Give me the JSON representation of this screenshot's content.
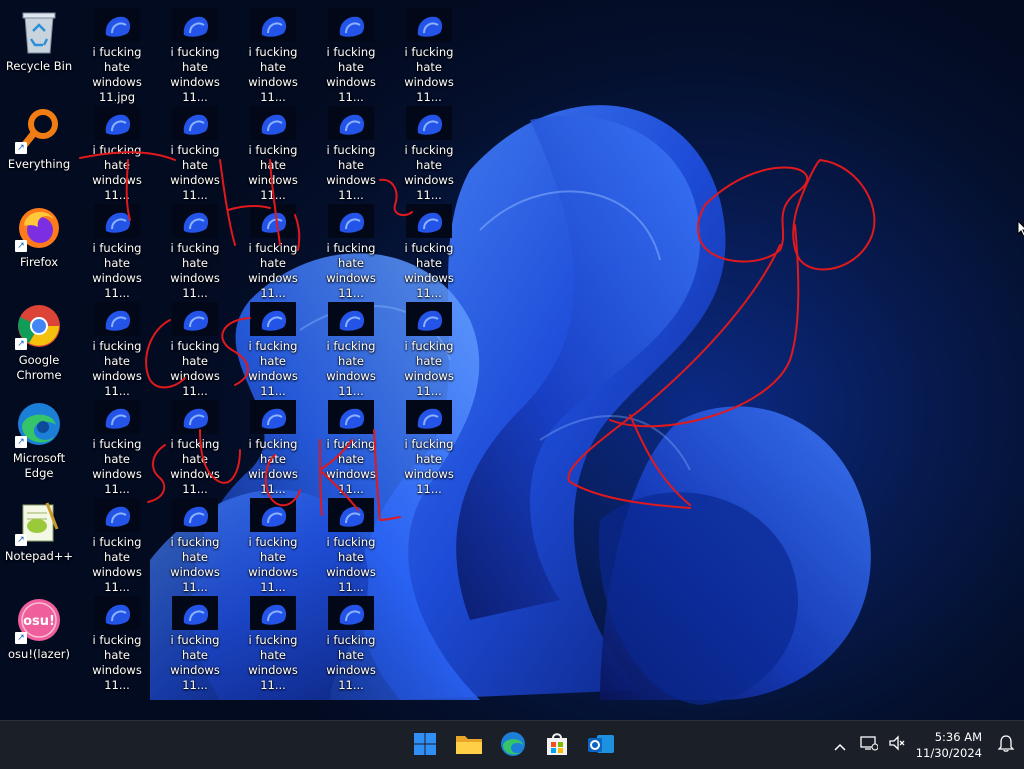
{
  "desktop": {
    "left_icons": [
      {
        "label": "Recycle Bin",
        "icon": "recycle-bin-icon"
      },
      {
        "label": "Everything",
        "icon": "everything-icon"
      },
      {
        "label": "Firefox",
        "icon": "firefox-icon"
      },
      {
        "label": "Google\nChrome",
        "icon": "chrome-icon"
      },
      {
        "label": "Microsoft\nEdge",
        "icon": "edge-icon"
      },
      {
        "label": "Notepad++",
        "icon": "notepadpp-icon"
      },
      {
        "label": "osu!(lazer)",
        "icon": "osu-icon",
        "badge": "osu!"
      }
    ],
    "file_first_label": "i fucking hate\nwindows\n11.jpg",
    "file_label": "i fucking hate\nwindows 11...",
    "file_rows": [
      [
        "i fucking hate\nwindows\n11.jpg",
        "i fucking hate\nwindows 11...",
        "i fucking hate\nwindows 11...",
        "i fucking hate\nwindows 11...",
        "i fucking hate\nwindows 11..."
      ],
      [
        "i fucking hate\nwindows 11...",
        "i fucking hate\nwindows 11...",
        "i fucking hate\nwindows 11...",
        "i fucking hate\nwindows 11...",
        "i fucking hate\nwindows 11..."
      ],
      [
        "i fucking hate\nwindows 11...",
        "i fucking hate\nwindows 11...",
        "i fucking hate\nwindows 11...",
        "i fucking hate\nwindows 11...",
        "i fucking hate\nwindows 11..."
      ],
      [
        "i fucking hate\nwindows 11...",
        "i fucking hate\nwindows 11...",
        "i fucking hate\nwindows 11...",
        "i fucking hate\nwindows 11...",
        "i fucking hate\nwindows 11..."
      ],
      [
        "i fucking hate\nwindows 11...",
        "i fucking hate\nwindows 11...",
        "i fucking hate\nwindows 11...",
        "i fucking hate\nwindows 11...",
        "i fucking hate\nwindows 11..."
      ],
      [
        "i fucking hate\nwindows 11...",
        "i fucking hate\nwindows 11...",
        "i fucking hate\nwindows 11...",
        "i fucking hate\nwindows 11..."
      ],
      [
        "i fucking hate\nwindows 11...",
        "i fucking hate\nwindows 11...",
        "i fucking hate\nwindows 11...",
        "i fucking hate\nwindows 11..."
      ]
    ],
    "scribble_color": "#e0191d"
  },
  "taskbar": {
    "pinned": [
      {
        "name": "start-button",
        "icon": "windows-logo-icon"
      },
      {
        "name": "file-explorer-button",
        "icon": "folder-icon"
      },
      {
        "name": "edge-taskbar-button",
        "icon": "edge-icon"
      },
      {
        "name": "store-taskbar-button",
        "icon": "store-icon"
      },
      {
        "name": "outlook-taskbar-button",
        "icon": "outlook-icon"
      }
    ],
    "tray": {
      "chevron_icon": "chevron-up-icon",
      "network_icon": "network-icon",
      "volume_icon": "volume-muted-icon",
      "time": "5:36 AM",
      "date": "11/30/2024",
      "notification_icon": "bell-icon"
    }
  },
  "colors": {
    "accent": "#1e6cf0",
    "taskbar": "#1b1f27"
  }
}
